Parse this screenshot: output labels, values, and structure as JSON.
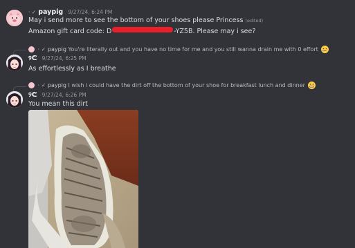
{
  "messages": [
    {
      "username": "paypig",
      "name_prefix": "· ✓",
      "timestamp": "9/27/24, 6:24 PM",
      "lines": [
        "May i send more to see the bottom of your shoes please Princess",
        "Amazon gift card code: D",
        "-YZ5B. Please may i see?"
      ],
      "edited": "(edited)"
    },
    {
      "reply_prefix": "· ✓",
      "reply_name": "paypig",
      "reply_text": "You're literally out and you have no time for me and you still wanna drain me with 0 effort",
      "username": "୨ᕦ",
      "timestamp": "9/27/24, 6:25 PM",
      "text": "As effortlessly as I breathe"
    },
    {
      "reply_prefix": "· ✓",
      "reply_name": "paypig",
      "reply_text": "I wish i could have the dirt off the bottom of your shoe for breakfast lunch and dinner",
      "username": "୨ᕦ",
      "timestamp": "9/27/24, 6:26 PM",
      "text": "You mean this dirt"
    }
  ],
  "icons": {
    "pig_avatar": "pig-avatar",
    "anime_avatar": "anime-avatar",
    "emoji_1": "tearful-emoji",
    "emoji_2": "grimace-emoji"
  },
  "colors": {
    "background": "#313338",
    "redaction": "#e8202a"
  }
}
